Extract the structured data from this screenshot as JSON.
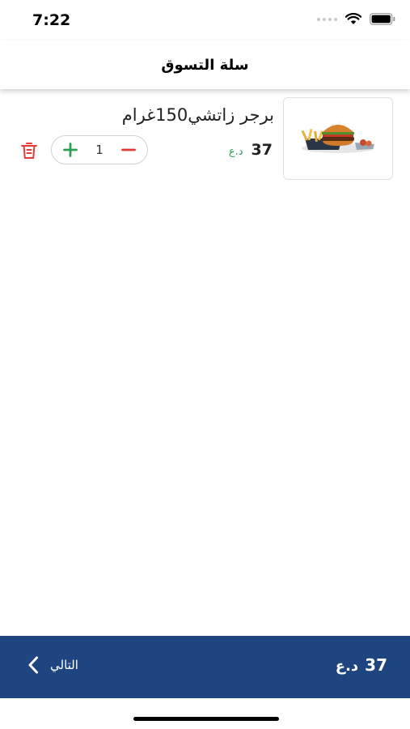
{
  "status_bar": {
    "time": "7:22"
  },
  "header": {
    "title": "سلة التسوق"
  },
  "cart": {
    "items": [
      {
        "name": "برجر زاتشي150غرام",
        "price": "37",
        "currency": "د.ع",
        "quantity": "1"
      }
    ]
  },
  "checkout": {
    "total": "37",
    "currency": "د.ع",
    "next_label": "التالي"
  },
  "colors": {
    "brand": "#1f4580",
    "price_currency": "#2e9e52",
    "plus": "#2e9e52",
    "minus": "#e53935",
    "delete": "#e53935"
  }
}
